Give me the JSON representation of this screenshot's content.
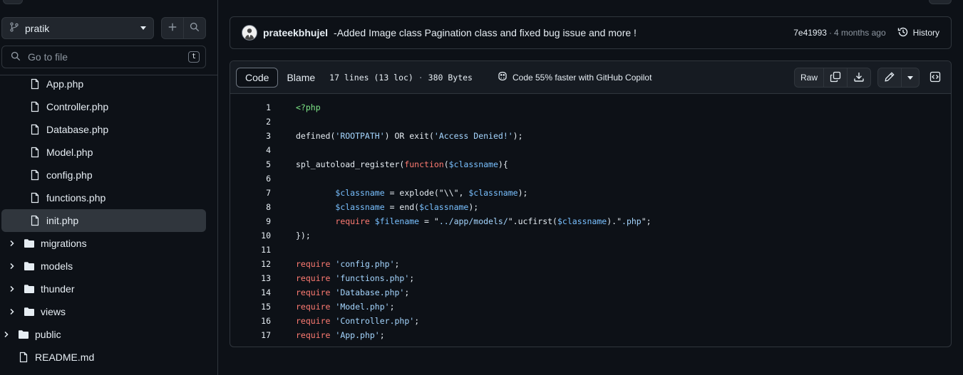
{
  "sidebar": {
    "branch": "pratik",
    "goto_placeholder": "Go to file",
    "goto_shortcut": "t",
    "tree": [
      {
        "name": "App.php",
        "type": "file",
        "depth": 2
      },
      {
        "name": "Controller.php",
        "type": "file",
        "depth": 2
      },
      {
        "name": "Database.php",
        "type": "file",
        "depth": 2
      },
      {
        "name": "Model.php",
        "type": "file",
        "depth": 2
      },
      {
        "name": "config.php",
        "type": "file",
        "depth": 2
      },
      {
        "name": "functions.php",
        "type": "file",
        "depth": 2
      },
      {
        "name": "init.php",
        "type": "file",
        "depth": 2,
        "active": true
      },
      {
        "name": "migrations",
        "type": "folder",
        "depth": 1
      },
      {
        "name": "models",
        "type": "folder",
        "depth": 1
      },
      {
        "name": "thunder",
        "type": "folder",
        "depth": 1
      },
      {
        "name": "views",
        "type": "folder",
        "depth": 1
      },
      {
        "name": "public",
        "type": "folder",
        "depth": 0
      },
      {
        "name": "README.md",
        "type": "file",
        "depth": 0
      }
    ]
  },
  "commit": {
    "author": "prateekbhujel",
    "message": "-Added Image class Pagination class and fixed bug issue and more !",
    "sha": "7e41993",
    "separator": "·",
    "time_ago": "4 months ago",
    "history_label": "History"
  },
  "file": {
    "tabs": [
      {
        "label": "Code",
        "active": true
      },
      {
        "label": "Blame",
        "active": false
      }
    ],
    "lines_info": "17 lines (13 loc)",
    "info_sep": "·",
    "size_info": "380 Bytes",
    "copilot_label": "Code 55% faster with GitHub Copilot",
    "raw_label": "Raw",
    "code_lines": [
      [
        {
          "t": "<?php",
          "c": "tag"
        }
      ],
      [],
      [
        {
          "t": "defined("
        },
        {
          "t": "'ROOTPATH'",
          "c": "s2"
        },
        {
          "t": ") OR exit("
        },
        {
          "t": "'Access Denied!'",
          "c": "s2"
        },
        {
          "t": ");"
        }
      ],
      [],
      [
        {
          "t": "spl_autoload_register("
        },
        {
          "t": "function",
          "c": "k"
        },
        {
          "t": "("
        },
        {
          "t": "$classname",
          "c": "v"
        },
        {
          "t": "){"
        }
      ],
      [],
      [
        {
          "t": "        "
        },
        {
          "t": "$classname",
          "c": "v"
        },
        {
          "t": " = explode(\"\\\\\", "
        },
        {
          "t": "$classname",
          "c": "v"
        },
        {
          "t": ");"
        }
      ],
      [
        {
          "t": "        "
        },
        {
          "t": "$classname",
          "c": "v"
        },
        {
          "t": " = end("
        },
        {
          "t": "$classname",
          "c": "v"
        },
        {
          "t": ");"
        }
      ],
      [
        {
          "t": "        "
        },
        {
          "t": "require",
          "c": "k"
        },
        {
          "t": " "
        },
        {
          "t": "$filename",
          "c": "v"
        },
        {
          "t": " = \""
        },
        {
          "t": "../app/models/",
          "c": "s2"
        },
        {
          "t": "\".ucfirst("
        },
        {
          "t": "$classname",
          "c": "v"
        },
        {
          "t": ").\""
        },
        {
          "t": ".php",
          "c": "s2"
        },
        {
          "t": "\";"
        }
      ],
      [
        {
          "t": "});"
        }
      ],
      [],
      [
        {
          "t": "require",
          "c": "k"
        },
        {
          "t": " "
        },
        {
          "t": "'config.php'",
          "c": "s2"
        },
        {
          "t": ";"
        }
      ],
      [
        {
          "t": "require",
          "c": "k"
        },
        {
          "t": " "
        },
        {
          "t": "'functions.php'",
          "c": "s2"
        },
        {
          "t": ";"
        }
      ],
      [
        {
          "t": "require",
          "c": "k"
        },
        {
          "t": " "
        },
        {
          "t": "'Database.php'",
          "c": "s2"
        },
        {
          "t": ";"
        }
      ],
      [
        {
          "t": "require",
          "c": "k"
        },
        {
          "t": " "
        },
        {
          "t": "'Model.php'",
          "c": "s2"
        },
        {
          "t": ";"
        }
      ],
      [
        {
          "t": "require",
          "c": "k"
        },
        {
          "t": " "
        },
        {
          "t": "'Controller.php'",
          "c": "s2"
        },
        {
          "t": ";"
        }
      ],
      [
        {
          "t": "require",
          "c": "k"
        },
        {
          "t": " "
        },
        {
          "t": "'App.php'",
          "c": "s2"
        },
        {
          "t": ";"
        }
      ]
    ]
  },
  "colors": {
    "background": "#0d1117",
    "border": "#30363d",
    "keyword": "#ff7b72",
    "string": "#a5d6ff",
    "variable": "#79c0ff",
    "php_tag": "#7ee787"
  }
}
